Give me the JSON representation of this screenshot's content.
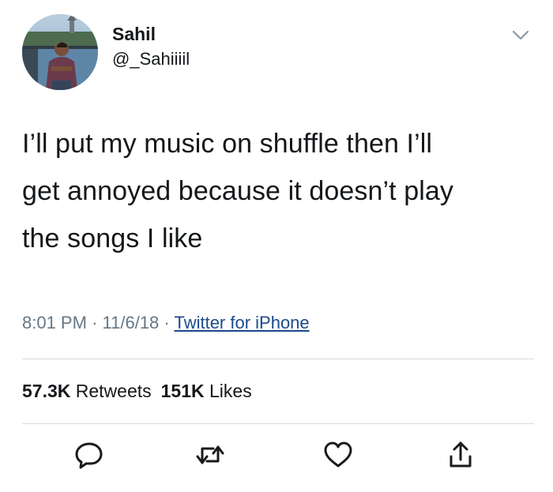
{
  "user": {
    "display_name": "Sahil",
    "handle": "@_Sahiiiil"
  },
  "tweet": {
    "text_lines": [
      "I’ll put my music on shuffle then I’ll",
      "get annoyed because it doesn’t play",
      "the songs I like"
    ],
    "time": "8:01 PM",
    "date": "11/6/18",
    "separator": "·",
    "source": "Twitter for iPhone"
  },
  "stats": {
    "retweets_count": "57.3K",
    "retweets_label": "Retweets",
    "likes_count": "151K",
    "likes_label": "Likes"
  },
  "icons": {
    "caret": "chevron-down-icon",
    "reply": "reply-icon",
    "retweet": "retweet-icon",
    "like": "heart-icon",
    "share": "share-icon"
  },
  "colors": {
    "text": "#14171a",
    "meta": "#657786",
    "link": "#1b4a8a",
    "divider": "#d6d9dc"
  }
}
